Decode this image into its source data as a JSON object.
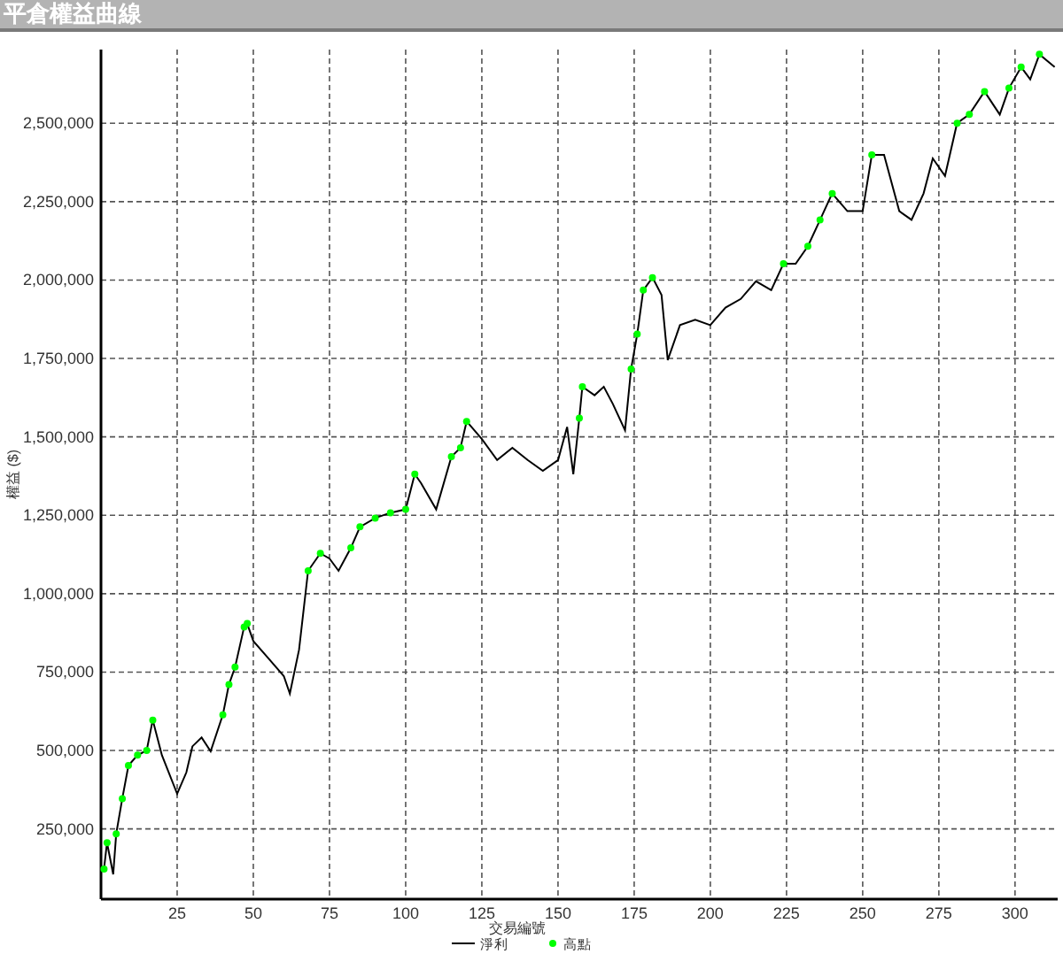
{
  "window": {
    "title": "平倉權益曲線"
  },
  "chart": {
    "chart_data": {
      "type": "line",
      "grid": true,
      "legend": "bottom",
      "xlabel": "交易編號",
      "ylabel": "權益 ($)",
      "xlim": [
        0,
        314
      ],
      "ylim": [
        26000,
        2735000
      ],
      "xticks": [
        25,
        50,
        75,
        100,
        125,
        150,
        175,
        200,
        225,
        250,
        275,
        300
      ],
      "yticks": [
        {
          "value": 250000,
          "label": "250,000"
        },
        {
          "value": 500000,
          "label": "500,000"
        },
        {
          "value": 750000,
          "label": "750,000"
        },
        {
          "value": 1000000,
          "label": "1,000,000"
        },
        {
          "value": 1250000,
          "label": "1,250,000"
        },
        {
          "value": 1500000,
          "label": "1,500,000"
        },
        {
          "value": 1750000,
          "label": "1,750,000"
        },
        {
          "value": 2000000,
          "label": "2,000,000"
        },
        {
          "value": 2250000,
          "label": "2,250,000"
        },
        {
          "value": 2500000,
          "label": "2,500,000"
        }
      ],
      "x": [
        1,
        2,
        4,
        5,
        7,
        9,
        12,
        15,
        17,
        20,
        25,
        28,
        30,
        33,
        36,
        40,
        42,
        44,
        47,
        48,
        50,
        55,
        60,
        62,
        65,
        68,
        72,
        75,
        78,
        82,
        85,
        90,
        95,
        100,
        103,
        105,
        110,
        115,
        118,
        120,
        125,
        130,
        135,
        140,
        145,
        150,
        153,
        155,
        157,
        158,
        162,
        165,
        168,
        172,
        174,
        176,
        178,
        181,
        184,
        186,
        190,
        195,
        200,
        205,
        210,
        215,
        220,
        224,
        228,
        232,
        236,
        240,
        245,
        250,
        253,
        257,
        262,
        266,
        270,
        273,
        277,
        281,
        285,
        290,
        295,
        298,
        302,
        305,
        308,
        313
      ],
      "series": [
        {
          "name": "淨利",
          "color": "#000000",
          "values": [
            122000,
            206000,
            105000,
            234000,
            346000,
            452000,
            485000,
            500000,
            597000,
            485000,
            362000,
            430000,
            513000,
            541000,
            497000,
            614000,
            710000,
            766000,
            894000,
            905000,
            849000,
            793000,
            737000,
            681000,
            821000,
            1073000,
            1129000,
            1112000,
            1073000,
            1146000,
            1213000,
            1241000,
            1258000,
            1269000,
            1381000,
            1353000,
            1269000,
            1437000,
            1465000,
            1549000,
            1493000,
            1426000,
            1465000,
            1426000,
            1392000,
            1426000,
            1532000,
            1381000,
            1560000,
            1660000,
            1633000,
            1660000,
            1605000,
            1521000,
            1716000,
            1828000,
            1968000,
            2008000,
            1952000,
            1745000,
            1856000,
            1873000,
            1856000,
            1912000,
            1940000,
            1996000,
            1968000,
            2052000,
            2052000,
            2108000,
            2192000,
            2276000,
            2220000,
            2220000,
            2399000,
            2399000,
            2220000,
            2192000,
            2276000,
            2388000,
            2332000,
            2500000,
            2528000,
            2601000,
            2528000,
            2612000,
            2679000,
            2640000,
            2720000,
            2679000
          ]
        },
        {
          "name": "高點",
          "color": "#00ff00",
          "type": "scatter",
          "values": [
            122000,
            206000,
            null,
            234000,
            346000,
            452000,
            485000,
            500000,
            597000,
            null,
            null,
            null,
            null,
            null,
            null,
            614000,
            710000,
            766000,
            894000,
            905000,
            null,
            null,
            null,
            null,
            null,
            1073000,
            1129000,
            null,
            null,
            1146000,
            1213000,
            1241000,
            1258000,
            1269000,
            1381000,
            null,
            null,
            1437000,
            1465000,
            1549000,
            null,
            null,
            null,
            null,
            null,
            null,
            null,
            null,
            1560000,
            1660000,
            null,
            null,
            null,
            null,
            1716000,
            1828000,
            1968000,
            2008000,
            null,
            null,
            null,
            null,
            null,
            null,
            null,
            null,
            null,
            2052000,
            null,
            2108000,
            2192000,
            2276000,
            null,
            null,
            2399000,
            null,
            null,
            null,
            null,
            null,
            null,
            2500000,
            2528000,
            2601000,
            null,
            2612000,
            2679000,
            null,
            2720000,
            null
          ]
        }
      ]
    }
  }
}
